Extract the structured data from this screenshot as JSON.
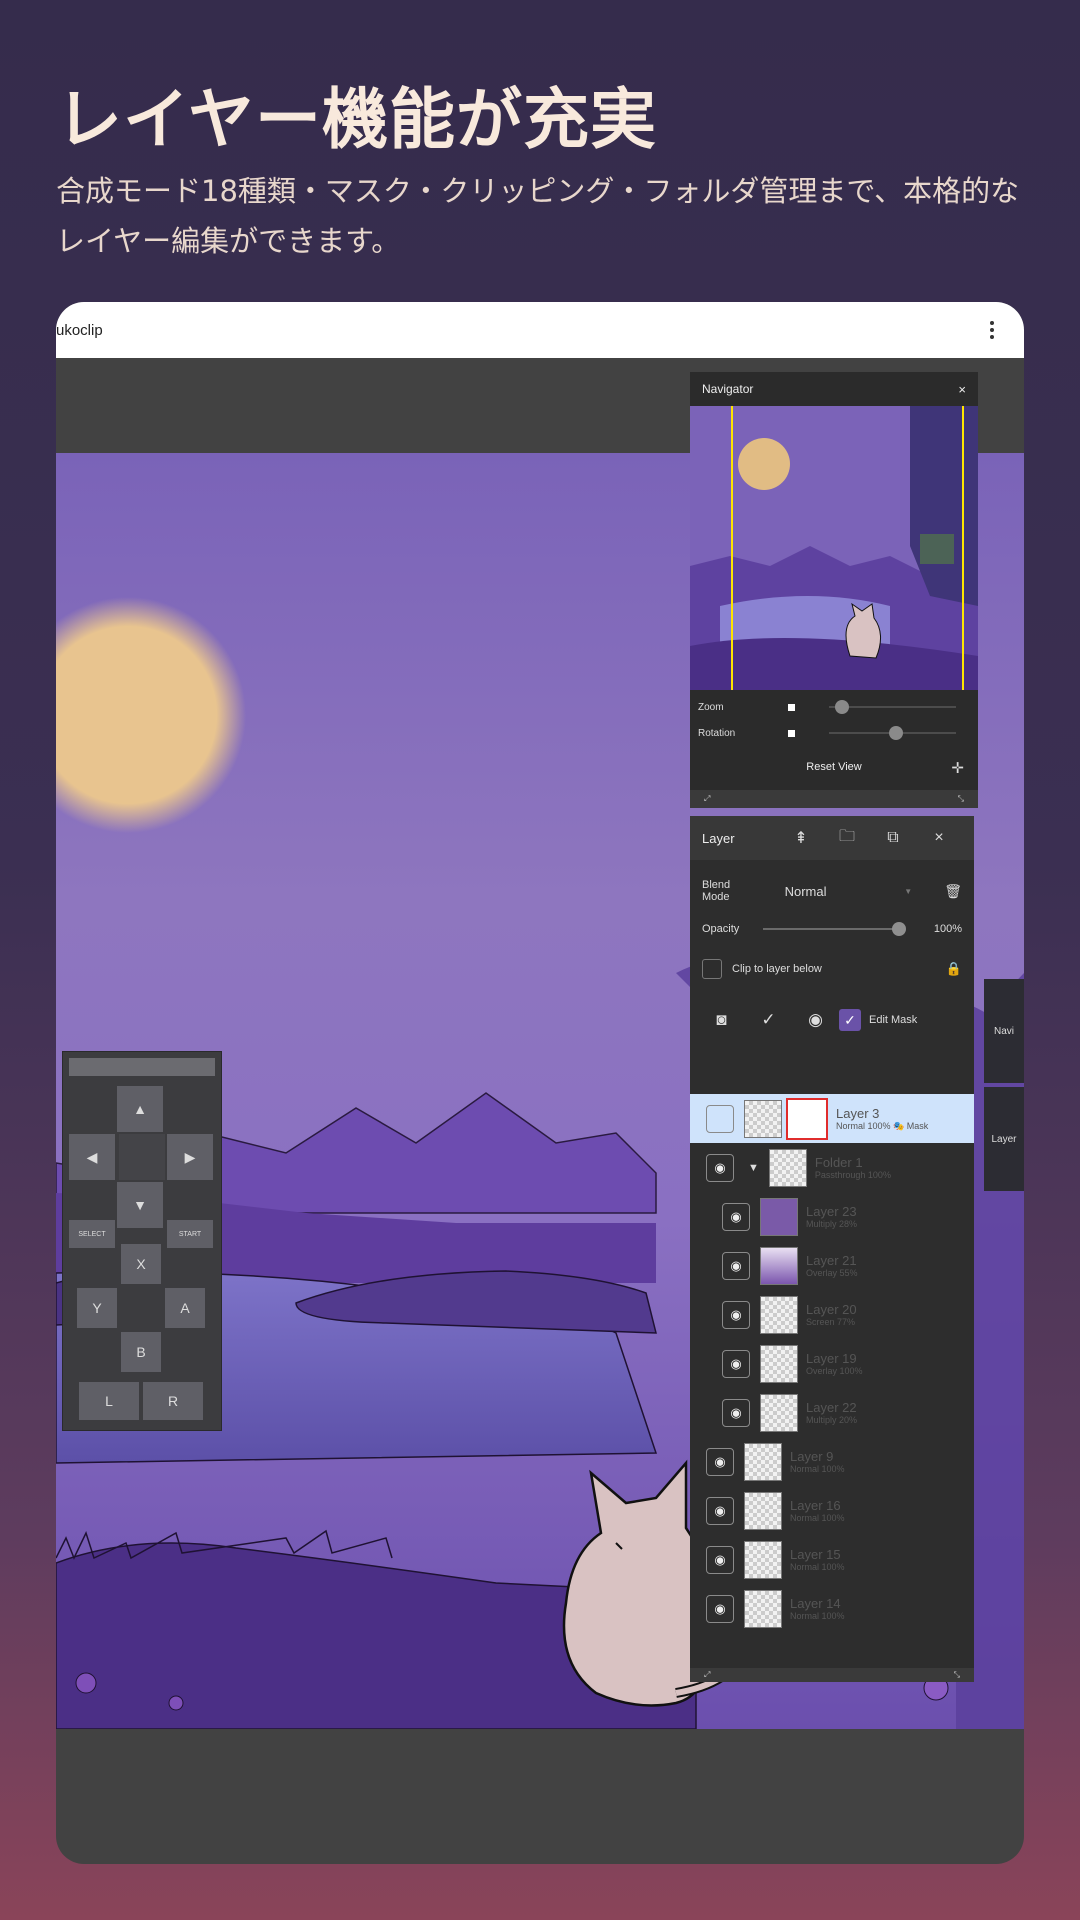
{
  "hero": {
    "title": "レイヤー機能が充実",
    "subtitle": "合成モード18種類・マスク・クリッピング・フォルダ管理まで、本格的なレイヤー編集ができます。"
  },
  "app": {
    "name": "ukoclip",
    "menu_icon": "more-vert-icon"
  },
  "gamepad": {
    "up": "▲",
    "left": "◀",
    "right": "▶",
    "down": "▼",
    "select": "SELECT",
    "start": "START",
    "x": "X",
    "y": "Y",
    "a": "A",
    "b": "B",
    "l": "L",
    "r": "R"
  },
  "navigator": {
    "title": "Navigator",
    "close": "×",
    "zoom_label": "Zoom",
    "rotation_label": "Rotation",
    "reset_label": "Reset View",
    "zoom_level": 0.05,
    "rotation_level": 0.5
  },
  "layer_panel": {
    "title": "Layer",
    "close": "×",
    "blend_mode_label": "Blend Mode",
    "blend_mode_value": "Normal",
    "opacity_label": "Opacity",
    "opacity_value": "100%",
    "clip_label": "Clip to layer below",
    "edit_mask_label": "Edit Mask",
    "layers": [
      {
        "name": "Layer 3",
        "info": "Normal 100% 🎭 Mask",
        "selected": true
      },
      {
        "name": "Folder 1",
        "info": "Passthrough 100%",
        "folder": true
      },
      {
        "name": "Layer 23",
        "info": "Multiply 28%",
        "indent": true
      },
      {
        "name": "Layer 21",
        "info": "Overlay 55%",
        "indent": true
      },
      {
        "name": "Layer 20",
        "info": "Screen 77%",
        "indent": true
      },
      {
        "name": "Layer 19",
        "info": "Overlay 100%",
        "indent": true
      },
      {
        "name": "Layer 22",
        "info": "Multiply 20%",
        "indent": true
      },
      {
        "name": "Layer 9",
        "info": "Normal 100%"
      },
      {
        "name": "Layer 16",
        "info": "Normal 100%"
      },
      {
        "name": "Layer 15",
        "info": "Normal 100%"
      },
      {
        "name": "Layer 14",
        "info": "Normal 100%"
      }
    ]
  },
  "side_tabs": {
    "navi": "Navi",
    "layer": "Layer"
  },
  "colors": {
    "background_top": "#352c4c",
    "background_bottom": "#8a4459",
    "accent": "#6a52a8",
    "selected_layer": "#cfe3fb",
    "moon": "#e8c48f"
  }
}
